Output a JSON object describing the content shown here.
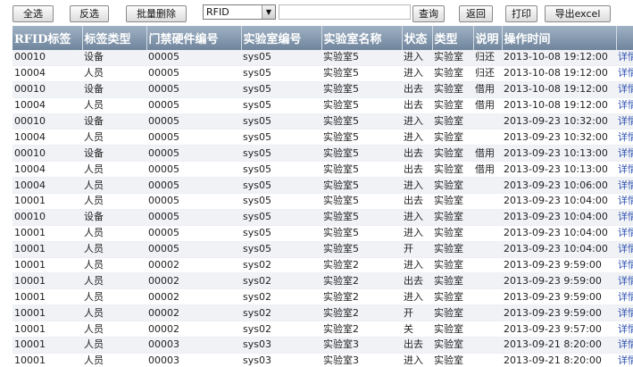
{
  "toolbar": {
    "select_all": "全选",
    "invert": "反选",
    "batch_delete": "批量删除",
    "filter_value": "RFID",
    "search_value": "",
    "query": "查询",
    "back": "返回",
    "print": "打印",
    "export": "导出excel"
  },
  "table": {
    "columns": [
      "RFID标签",
      "标签类型",
      "门禁硬件编号",
      "实验室编号",
      "实验室名称",
      "状态",
      "类型",
      "说明",
      "操作时间",
      ""
    ],
    "rows": [
      [
        "00010",
        "设备",
        "00005",
        "sys05",
        "实验室5",
        "进入",
        "实验室",
        "归还",
        "2013-10-08 19:12:00",
        "详情"
      ],
      [
        "10004",
        "人员",
        "00005",
        "sys05",
        "实验室5",
        "进入",
        "实验室",
        "归还",
        "2013-10-08 19:12:00",
        "详情"
      ],
      [
        "00010",
        "设备",
        "00005",
        "sys05",
        "实验室5",
        "出去",
        "实验室",
        "借用",
        "2013-10-08 19:12:00",
        "详情"
      ],
      [
        "10004",
        "人员",
        "00005",
        "sys05",
        "实验室5",
        "出去",
        "实验室",
        "借用",
        "2013-10-08 19:12:00",
        "详情"
      ],
      [
        "00010",
        "设备",
        "00005",
        "sys05",
        "实验室5",
        "进入",
        "实验室",
        "",
        "2013-09-23 10:32:00",
        "详情"
      ],
      [
        "10004",
        "人员",
        "00005",
        "sys05",
        "实验室5",
        "进入",
        "实验室",
        "",
        "2013-09-23 10:32:00",
        "详情"
      ],
      [
        "00010",
        "设备",
        "00005",
        "sys05",
        "实验室5",
        "出去",
        "实验室",
        "借用",
        "2013-09-23 10:13:00",
        "详情"
      ],
      [
        "10004",
        "人员",
        "00005",
        "sys05",
        "实验室5",
        "出去",
        "实验室",
        "借用",
        "2013-09-23 10:13:00",
        "详情"
      ],
      [
        "10004",
        "人员",
        "00005",
        "sys05",
        "实验室5",
        "进入",
        "实验室",
        "",
        "2013-09-23 10:06:00",
        "详情"
      ],
      [
        "10001",
        "人员",
        "00005",
        "sys05",
        "实验室5",
        "出去",
        "实验室",
        "",
        "2013-09-23 10:04:00",
        "详情"
      ],
      [
        "00010",
        "设备",
        "00005",
        "sys05",
        "实验室5",
        "进入",
        "实验室",
        "",
        "2013-09-23 10:04:00",
        "详情"
      ],
      [
        "10001",
        "人员",
        "00005",
        "sys05",
        "实验室5",
        "进入",
        "实验室",
        "",
        "2013-09-23 10:04:00",
        "详情"
      ],
      [
        "10001",
        "人员",
        "00005",
        "sys05",
        "实验室5",
        "开",
        "实验室",
        "",
        "2013-09-23 10:04:00",
        "详情"
      ],
      [
        "10001",
        "人员",
        "00002",
        "sys02",
        "实验室2",
        "进入",
        "实验室",
        "",
        "2013-09-23 9:59:00",
        "详情"
      ],
      [
        "10001",
        "人员",
        "00002",
        "sys02",
        "实验室2",
        "出去",
        "实验室",
        "",
        "2013-09-23 9:59:00",
        "详情"
      ],
      [
        "10001",
        "人员",
        "00002",
        "sys02",
        "实验室2",
        "进入",
        "实验室",
        "",
        "2013-09-23 9:59:00",
        "详情"
      ],
      [
        "10001",
        "人员",
        "00002",
        "sys02",
        "实验室2",
        "开",
        "实验室",
        "",
        "2013-09-23 9:59:00",
        "详情"
      ],
      [
        "10001",
        "人员",
        "00002",
        "sys02",
        "实验室2",
        "关",
        "实验室",
        "",
        "2013-09-23 9:57:00",
        "详情"
      ],
      [
        "10001",
        "人员",
        "00003",
        "sys03",
        "实验室3",
        "出去",
        "实验室",
        "",
        "2013-09-21 8:20:00",
        "详情"
      ],
      [
        "10001",
        "人员",
        "00003",
        "sys03",
        "实验室3",
        "进入",
        "实验室",
        "",
        "2013-09-21 8:20:00",
        "详情"
      ]
    ]
  }
}
